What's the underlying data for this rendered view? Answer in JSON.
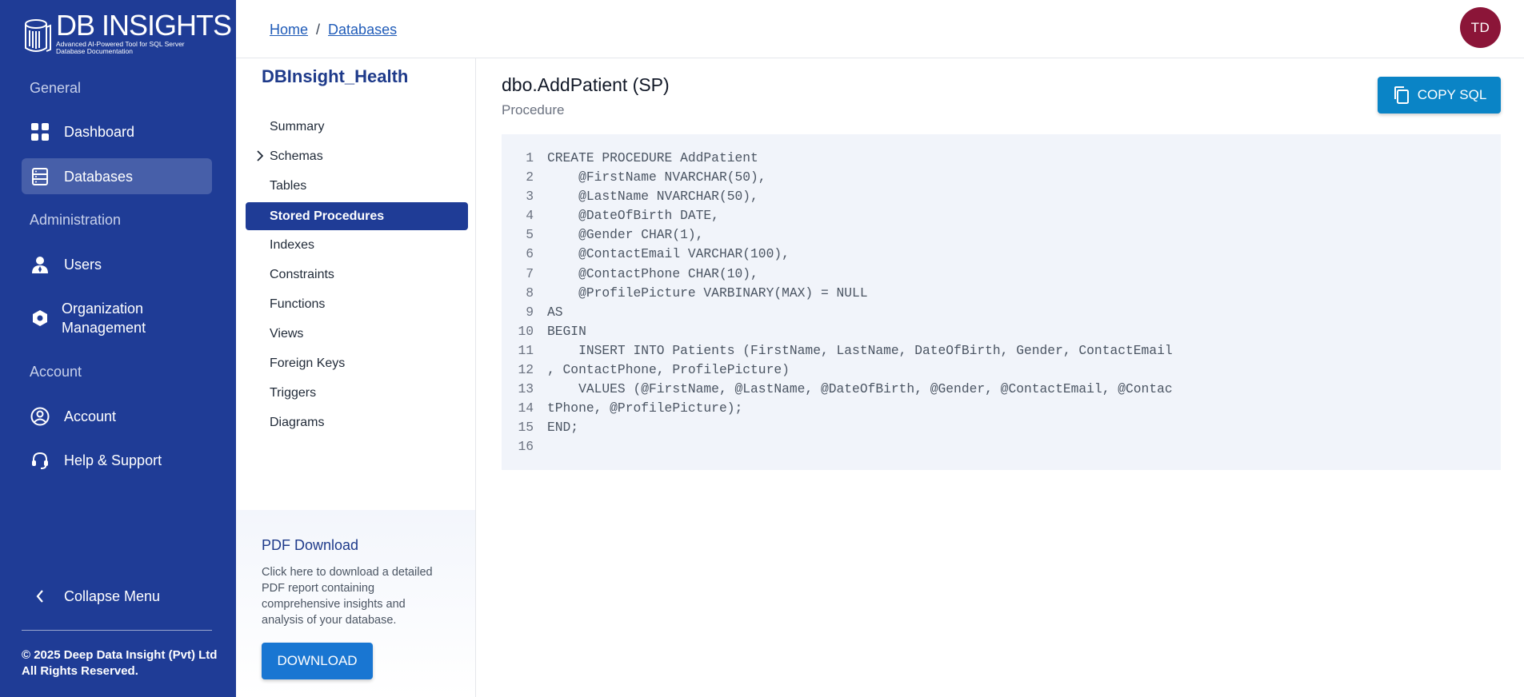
{
  "sidebar": {
    "logo_title": "DB INSIGHTS",
    "logo_subtitle": "Advanced AI-Powered Tool for SQL Server Database Documentation",
    "sections": {
      "general": "General",
      "administration": "Administration",
      "account": "Account"
    },
    "items": [
      {
        "label": "Dashboard",
        "icon": "grid-icon"
      },
      {
        "label": "Databases",
        "icon": "database-icon"
      },
      {
        "label": "Users",
        "icon": "user-icon"
      },
      {
        "label": "Organization Management",
        "icon": "organization-icon"
      },
      {
        "label": "Account",
        "icon": "account-circle-icon"
      },
      {
        "label": "Help & Support",
        "icon": "headset-icon"
      }
    ],
    "collapse_label": "Collapse Menu",
    "copyright_line1": "© 2025 Deep Data Insight (Pvt) Ltd",
    "copyright_line2": "All Rights Reserved."
  },
  "header": {
    "breadcrumb": [
      "Home",
      "Databases"
    ],
    "avatar_initials": "TD",
    "avatar_color": "#8b1538"
  },
  "panel": {
    "db_name": "DBInsight_Health",
    "menu": [
      "Summary",
      "Schemas",
      "Tables",
      "Stored Procedures",
      "Indexes",
      "Constraints",
      "Functions",
      "Views",
      "Foreign Keys",
      "Triggers",
      "Diagrams"
    ],
    "active_menu": "Stored Procedures",
    "pdf": {
      "title": "PDF Download",
      "description": "Click here to download a detailed PDF report containing comprehensive insights and analysis of your database.",
      "button": "DOWNLOAD"
    }
  },
  "main": {
    "title": "dbo.AddPatient (SP)",
    "type": "Procedure",
    "copy_button": "COPY SQL",
    "code_lines": [
      "CREATE PROCEDURE AddPatient",
      "    @FirstName NVARCHAR(50),",
      "    @LastName NVARCHAR(50),",
      "    @DateOfBirth DATE,",
      "    @Gender CHAR(1),",
      "    @ContactEmail VARCHAR(100),",
      "    @ContactPhone CHAR(10),",
      "    @ProfilePicture VARBINARY(MAX) = NULL",
      "AS",
      "BEGIN",
      "    INSERT INTO Patients (FirstName, LastName, DateOfBirth, Gender, ContactEmail",
      ", ContactPhone, ProfilePicture)",
      "    VALUES (@FirstName, @LastName, @DateOfBirth, @Gender, @ContactEmail, @Contac",
      "tPhone, @ProfilePicture);",
      "END;",
      ""
    ]
  },
  "colors": {
    "sidebar_bg": "#1f3c96",
    "accent": "#1976d2",
    "copy_button": "#0a84c6"
  }
}
